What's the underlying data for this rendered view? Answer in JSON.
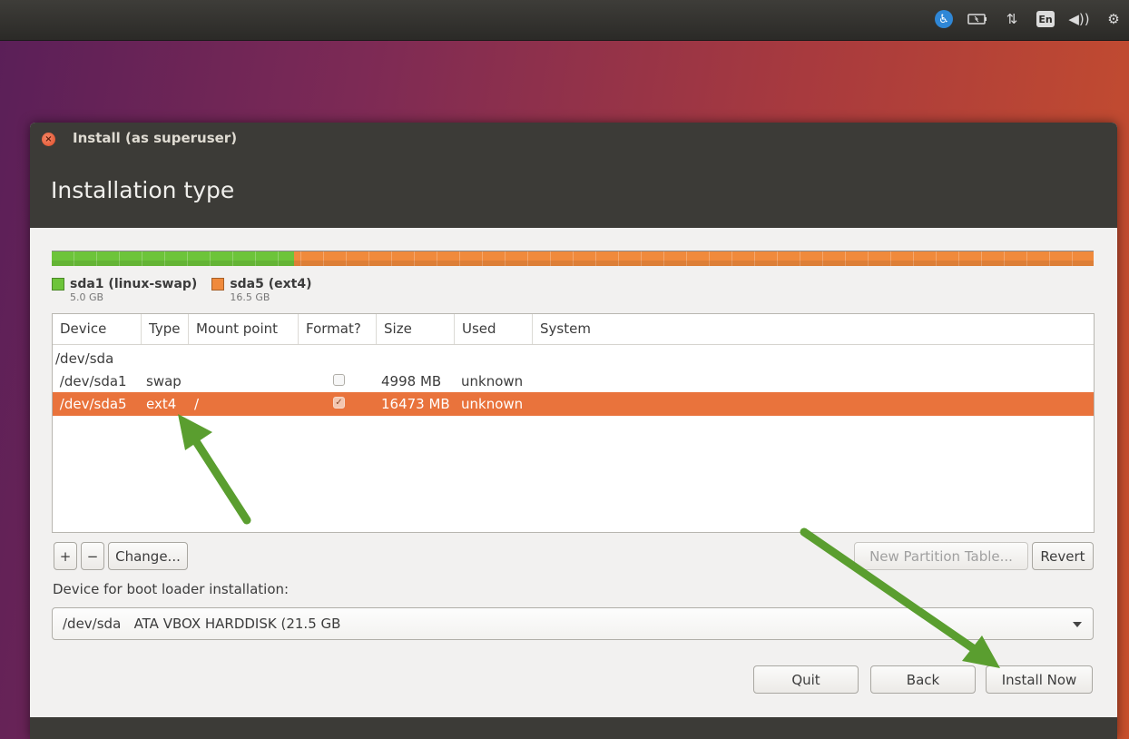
{
  "topbar": {
    "language": "En"
  },
  "window": {
    "title": "Install (as superuser)",
    "page_title": "Installation type"
  },
  "partition_bar": {
    "partitions": [
      {
        "name": "sda1 (linux-swap)",
        "size": "5.0 GB",
        "color": "#6dc43a",
        "fraction": 0.233
      },
      {
        "name": "sda5 (ext4)",
        "size": "16.5 GB",
        "color": "#f08a3c",
        "fraction": 0.767
      }
    ]
  },
  "table": {
    "headers": [
      "Device",
      "Type",
      "Mount point",
      "Format?",
      "Size",
      "Used",
      "System"
    ],
    "rows": [
      {
        "device": "/dev/sda",
        "type": "",
        "mount": "",
        "format": null,
        "size": "",
        "used": "",
        "system": ""
      },
      {
        "device": " /dev/sda1",
        "type": "swap",
        "mount": "",
        "format": false,
        "size": "4998 MB",
        "used": "unknown",
        "system": ""
      },
      {
        "device": " /dev/sda5",
        "type": "ext4",
        "mount": "/",
        "format": true,
        "size": "16473 MB",
        "used": "unknown",
        "system": "",
        "selected": true
      }
    ]
  },
  "controls": {
    "add_label": "+",
    "remove_label": "−",
    "change_label": "Change...",
    "new_table_label": "New Partition Table...",
    "revert_label": "Revert"
  },
  "bootloader": {
    "label": "Device for boot loader installation:",
    "value": "/dev/sda   ATA VBOX HARDDISK (21.5 GB"
  },
  "actions": {
    "quit_label": "Quit",
    "back_label": "Back",
    "install_label": "Install Now"
  },
  "colors": {
    "accent": "#e9733c",
    "arrow": "#5a9e2f"
  }
}
